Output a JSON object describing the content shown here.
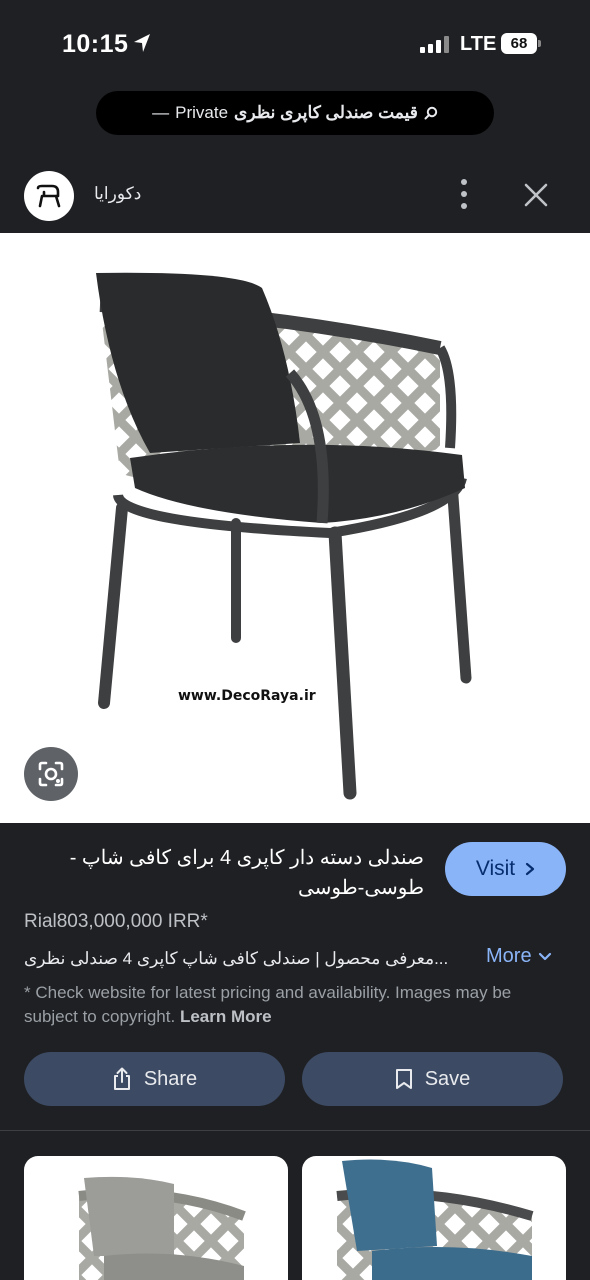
{
  "status_bar": {
    "time": "10:15",
    "network": "LTE",
    "battery": "68"
  },
  "search_pill": {
    "query": "قیمت صندلی کاپری نظری",
    "mode": "Private",
    "separator": "—"
  },
  "source": {
    "name": "دکورایا"
  },
  "image": {
    "watermark": "www.DecoRaya.ir"
  },
  "product": {
    "title": "صندلی دسته دار کاپری 4 برای کافی شاپ - طوسی-طوسی",
    "price": "Rial803,000,000 IRR*",
    "description": "...معرفی محصول | صندلی کافی شاپ کاپری 4 صندلی نظری",
    "more_label": "More",
    "visit_label": "Visit",
    "disclaimer": "* Check website for latest pricing and availability. Images may be subject to copyright.",
    "learn_more": "Learn More"
  },
  "actions": {
    "share_label": "Share",
    "save_label": "Save"
  },
  "colors": {
    "background": "#1f2023",
    "accent": "#8ab4f8",
    "action_button": "#3c4a63"
  }
}
